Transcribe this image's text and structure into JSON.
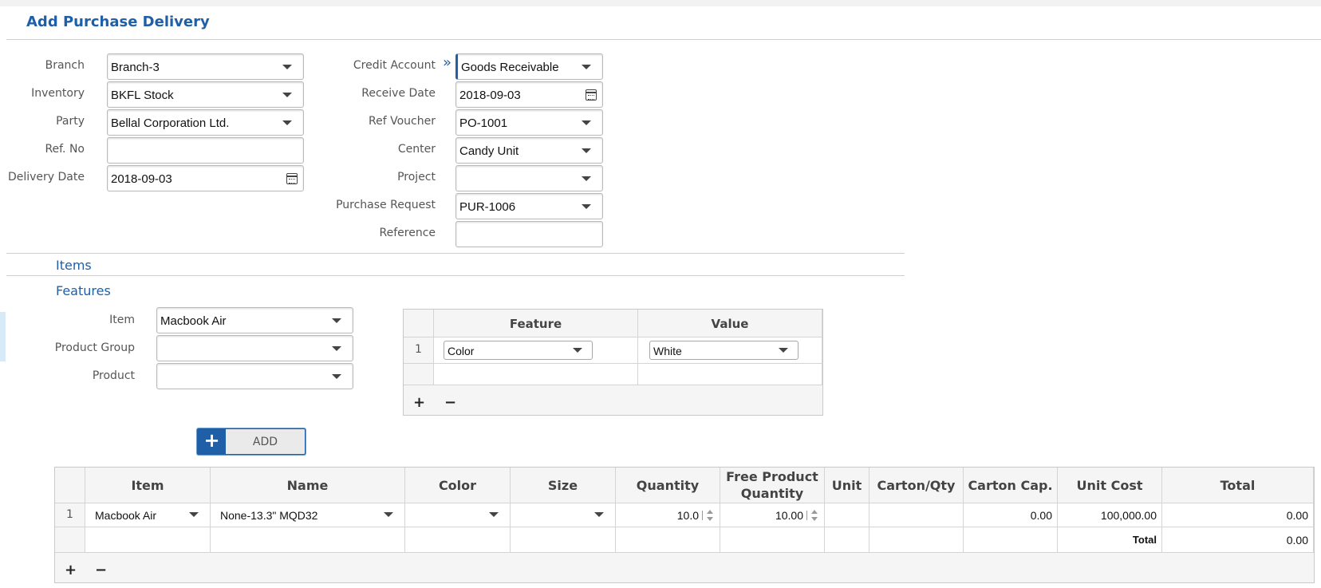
{
  "page": {
    "title": "Add Purchase Delivery"
  },
  "form_left": {
    "branch": {
      "label": "Branch",
      "value": "Branch-3"
    },
    "inventory": {
      "label": "Inventory",
      "value": "BKFL Stock"
    },
    "party": {
      "label": "Party",
      "value": "Bellal Corporation Ltd."
    },
    "ref_no": {
      "label": "Ref. No",
      "value": ""
    },
    "delivery_date": {
      "label": "Delivery Date",
      "value": "2018-09-03"
    }
  },
  "form_right": {
    "credit_account": {
      "label": "Credit Account",
      "value": "Goods Receivable",
      "expand_icon": "»"
    },
    "receive_date": {
      "label": "Receive Date",
      "value": "2018-09-03"
    },
    "ref_voucher": {
      "label": "Ref Voucher",
      "value": "PO-1001"
    },
    "center": {
      "label": "Center",
      "value": "Candy Unit"
    },
    "project": {
      "label": "Project",
      "value": ""
    },
    "purchase_request": {
      "label": "Purchase Request",
      "value": "PUR-1006"
    },
    "reference": {
      "label": "Reference",
      "value": ""
    }
  },
  "sections": {
    "items": "Items",
    "features": "Features"
  },
  "features_form": {
    "item": {
      "label": "Item",
      "value": "Macbook Air"
    },
    "product_group": {
      "label": "Product Group",
      "value": ""
    },
    "product": {
      "label": "Product",
      "value": ""
    }
  },
  "feature_grid": {
    "columns": [
      "Feature",
      "Value"
    ],
    "rows": [
      {
        "num": "1",
        "feature": "Color",
        "value": "White"
      }
    ],
    "add_label": "+",
    "remove_label": "−"
  },
  "add_button": {
    "icon": "+",
    "label": "ADD"
  },
  "item_grid": {
    "columns": [
      "Item",
      "Name",
      "Color",
      "Size",
      "Quantity",
      "Free Product Quantity",
      "Unit",
      "Carton/Qty",
      "Carton Cap.",
      "Unit Cost",
      "Total"
    ],
    "rows": [
      {
        "num": "1",
        "item": "Macbook Air",
        "name": "None-13.3\" MQD32",
        "color": "",
        "size": "",
        "quantity": "10.0",
        "free_quantity": "10.00",
        "unit": "",
        "carton_qty": "",
        "carton_cap": "0.00",
        "unit_cost": "100,000.00",
        "total": "0.00"
      }
    ],
    "footer": {
      "total_label": "Total",
      "total_value": "0.00"
    },
    "add_label": "+",
    "remove_label": "−"
  },
  "colors": {
    "accent": "#1f5fa8",
    "border": "#b9b9b9",
    "grid_bg": "#f5f5f5"
  }
}
